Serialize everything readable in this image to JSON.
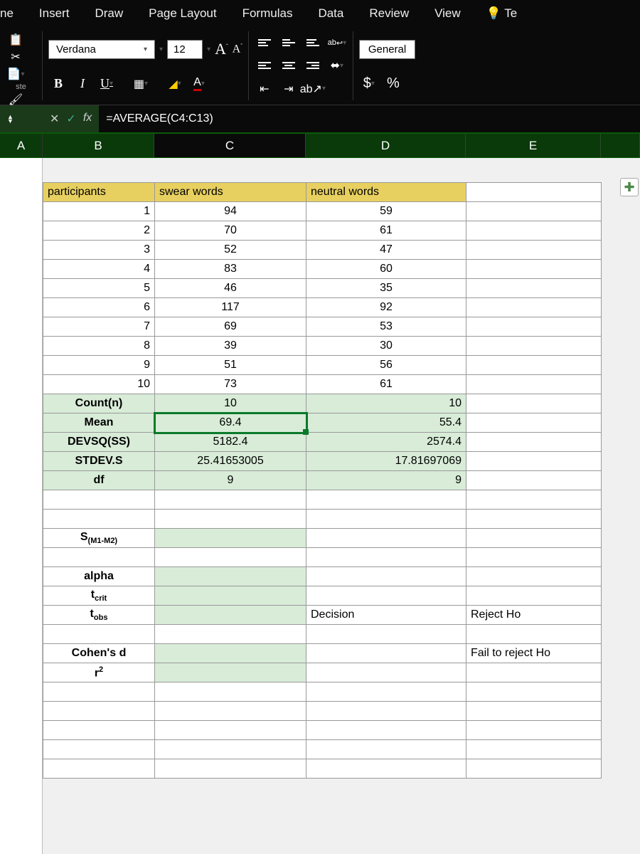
{
  "tabs": {
    "home_partial": "ne",
    "insert": "Insert",
    "draw": "Draw",
    "page_layout": "Page Layout",
    "formulas": "Formulas",
    "data": "Data",
    "review": "Review",
    "view": "View",
    "tell_partial": "Te"
  },
  "toolbar": {
    "paste_label": "ste",
    "font_name": "Verdana",
    "font_size": "12",
    "bold": "B",
    "italic": "I",
    "underline": "U",
    "wrap_text": "ab",
    "number_format": "General",
    "currency": "$",
    "percent": "%"
  },
  "formula_bar": {
    "fx": "fx",
    "formula": "=AVERAGE(C4:C13)"
  },
  "columns": {
    "A": "A",
    "B": "B",
    "C": "C",
    "D": "D",
    "E": "E"
  },
  "headers": {
    "participants": "participants",
    "swear": "swear words",
    "neutral": "neutral words"
  },
  "data_rows": [
    {
      "p": "1",
      "s": "94",
      "n": "59"
    },
    {
      "p": "2",
      "s": "70",
      "n": "61"
    },
    {
      "p": "3",
      "s": "52",
      "n": "47"
    },
    {
      "p": "4",
      "s": "83",
      "n": "60"
    },
    {
      "p": "5",
      "s": "46",
      "n": "35"
    },
    {
      "p": "6",
      "s": "117",
      "n": "92"
    },
    {
      "p": "7",
      "s": "69",
      "n": "53"
    },
    {
      "p": "8",
      "s": "39",
      "n": "30"
    },
    {
      "p": "9",
      "s": "51",
      "n": "56"
    },
    {
      "p": "10",
      "s": "73",
      "n": "61"
    }
  ],
  "stats": {
    "count_label": "Count(n)",
    "count_s": "10",
    "count_n": "10",
    "mean_label": "Mean",
    "mean_s": "69.4",
    "mean_n": "55.4",
    "devsq_label": "DEVSQ(SS)",
    "devsq_s": "5182.4",
    "devsq_n": "2574.4",
    "stdev_label": "STDEV.S",
    "stdev_s": "25.41653005",
    "stdev_n": "17.81697069",
    "df_label": "df",
    "df_s": "9",
    "df_n": "9"
  },
  "labels": {
    "s_m1m2_pre": "S",
    "s_m1m2_sub": "(M1-M2)",
    "alpha": "alpha",
    "tcrit_pre": "t",
    "tcrit_sub": "crit",
    "tobs_pre": "t",
    "tobs_sub": "obs",
    "decision": "Decision",
    "reject": "Reject Ho",
    "fail": "Fail to reject Ho",
    "cohen": "Cohen's d",
    "r2_pre": "r",
    "r2_sup": "2"
  }
}
